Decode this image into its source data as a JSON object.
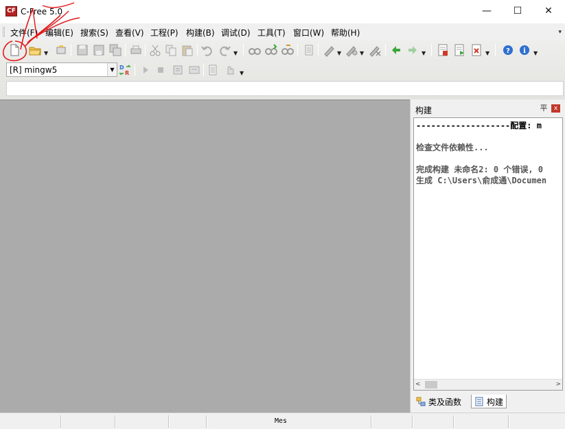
{
  "window": {
    "app_icon_text": "CF",
    "title": "C-Free 5.0",
    "minimize_glyph": "—",
    "maximize_glyph": "☐",
    "close_glyph": "✕"
  },
  "menu": {
    "items": [
      {
        "label": "文件(F)"
      },
      {
        "label": "编辑(E)"
      },
      {
        "label": "搜索(S)"
      },
      {
        "label": "查看(V)"
      },
      {
        "label": "工程(P)"
      },
      {
        "label": "构建(B)"
      },
      {
        "label": "调试(D)"
      },
      {
        "label": "工具(T)"
      },
      {
        "label": "窗口(W)"
      },
      {
        "label": "帮助(H)"
      }
    ],
    "overflow_glyph": "▾"
  },
  "toolbar": {
    "icons": [
      "new-file-icon",
      "open-folder-icon",
      "save-icon",
      "save-all-icon",
      "cut-icon",
      "copy-icon",
      "paste-icon",
      "undo-icon",
      "redo-icon",
      "find-icon",
      "replace-icon",
      "back-icon",
      "forward-icon",
      "help-icon",
      "info-icon"
    ],
    "config_combo_value": "[R] mingw5",
    "accent_colors": {
      "help_blue": "#2f6fd0",
      "nav_green": "#3aa63a",
      "run_red": "#d03a2a"
    }
  },
  "editor": {
    "background": "#ababab"
  },
  "build_panel": {
    "title": "构建",
    "pin_glyph": "平",
    "close_glyph": "x",
    "output_lines": [
      "-------------------配置: m",
      "",
      "检查文件依赖性...",
      "",
      "完成构建 未命名2: 0 个错误, 0",
      "生成 C:\\Users\\俞成通\\Documen"
    ],
    "scroll_left_glyph": "<",
    "scroll_right_glyph": ">",
    "tabs": [
      {
        "label": "类及函数",
        "icon": "class-tree-icon"
      },
      {
        "label": "构建",
        "icon": "build-output-icon"
      }
    ]
  },
  "statusbar": {
    "text": "Mes"
  }
}
